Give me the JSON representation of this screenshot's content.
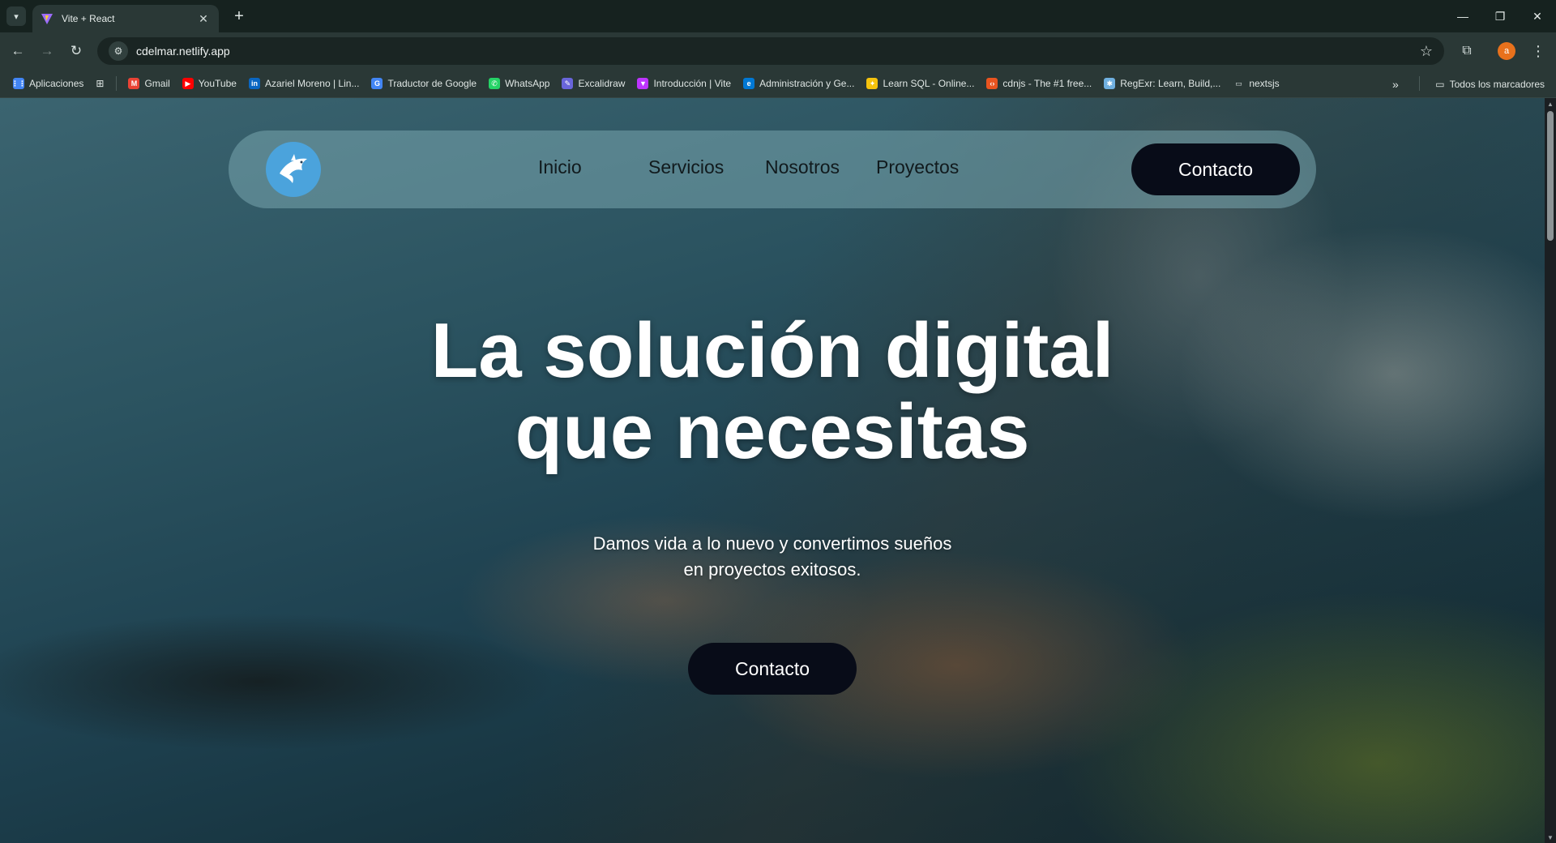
{
  "browser": {
    "tab_title": "Vite + React",
    "url": "cdelmar.netlify.app",
    "profile_initial": "a",
    "bookmarks": [
      {
        "label": "Aplicaciones",
        "icon": "apps-grid-icon",
        "color": "#4285f4"
      },
      {
        "label": "Gmail",
        "icon": "gmail-icon",
        "color": "#ea4335"
      },
      {
        "label": "YouTube",
        "icon": "youtube-icon",
        "color": "#ff0000"
      },
      {
        "label": "Azariel Moreno | Lin...",
        "icon": "linkedin-icon",
        "color": "#0a66c2"
      },
      {
        "label": "Traductor de Google",
        "icon": "google-translate-icon",
        "color": "#4285f4"
      },
      {
        "label": "WhatsApp",
        "icon": "whatsapp-icon",
        "color": "#25d366"
      },
      {
        "label": "Excalidraw",
        "icon": "excalidraw-icon",
        "color": "#6965db"
      },
      {
        "label": "Introducción | Vite",
        "icon": "vite-icon",
        "color": "#bd34fe"
      },
      {
        "label": "Administración y Ge...",
        "icon": "edge-icon",
        "color": "#0078d4"
      },
      {
        "label": "Learn SQL - Online...",
        "icon": "bulb-icon",
        "color": "#f4c20d"
      },
      {
        "label": "cdnjs - The #1 free...",
        "icon": "code-icon",
        "color": "#e95420"
      },
      {
        "label": "RegExr: Learn, Build,...",
        "icon": "regexr-icon",
        "color": "#70b0e0"
      },
      {
        "label": "nextsjs",
        "icon": "folder-icon",
        "color": "#dfe6e4"
      }
    ],
    "all_bookmarks_label": "Todos los marcadores"
  },
  "site": {
    "nav": {
      "links": [
        "Inicio",
        "Servicios",
        "Nosotros",
        "Proyectos"
      ],
      "cta": "Contacto"
    },
    "hero": {
      "title_line1": "La solución digital",
      "title_line2": "que necesitas",
      "subtitle_line1": "Damos vida a lo nuevo y convertimos sueños",
      "subtitle_line2": "en proyectos exitosos.",
      "cta": "Contacto"
    }
  },
  "colors": {
    "cta_bg": "#080c18",
    "logo_bg": "#4ba3dc",
    "navbar_bg": "rgba(120,165,175,0.55)"
  }
}
